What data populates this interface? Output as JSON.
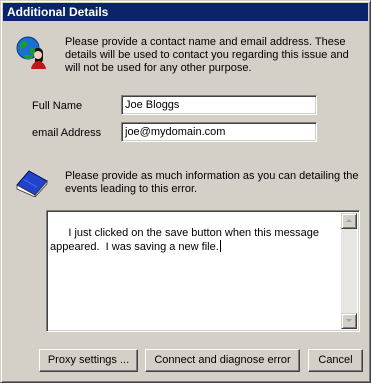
{
  "window": {
    "title": "Additional Details"
  },
  "contact": {
    "intro": "Please provide a contact name and email address.  These details will be used to contact you regarding this issue and will not be used for any other purpose.",
    "full_name_label": "Full Name",
    "full_name_value": "Joe Bloggs",
    "email_label": "email Address",
    "email_value": "joe@mydomain.com",
    "icon": "globe-person-icon"
  },
  "details": {
    "intro": "Please provide as much information as you can detailing the events leading to this error.",
    "text": "I just clicked on the save button when this message appeared.  I was saving a new file.",
    "icon": "book-icon"
  },
  "buttons": {
    "proxy": "Proxy settings ...",
    "connect": "Connect and diagnose error",
    "cancel": "Cancel"
  },
  "colors": {
    "titlebar": "#0a246a",
    "face": "#d4d0c8"
  }
}
